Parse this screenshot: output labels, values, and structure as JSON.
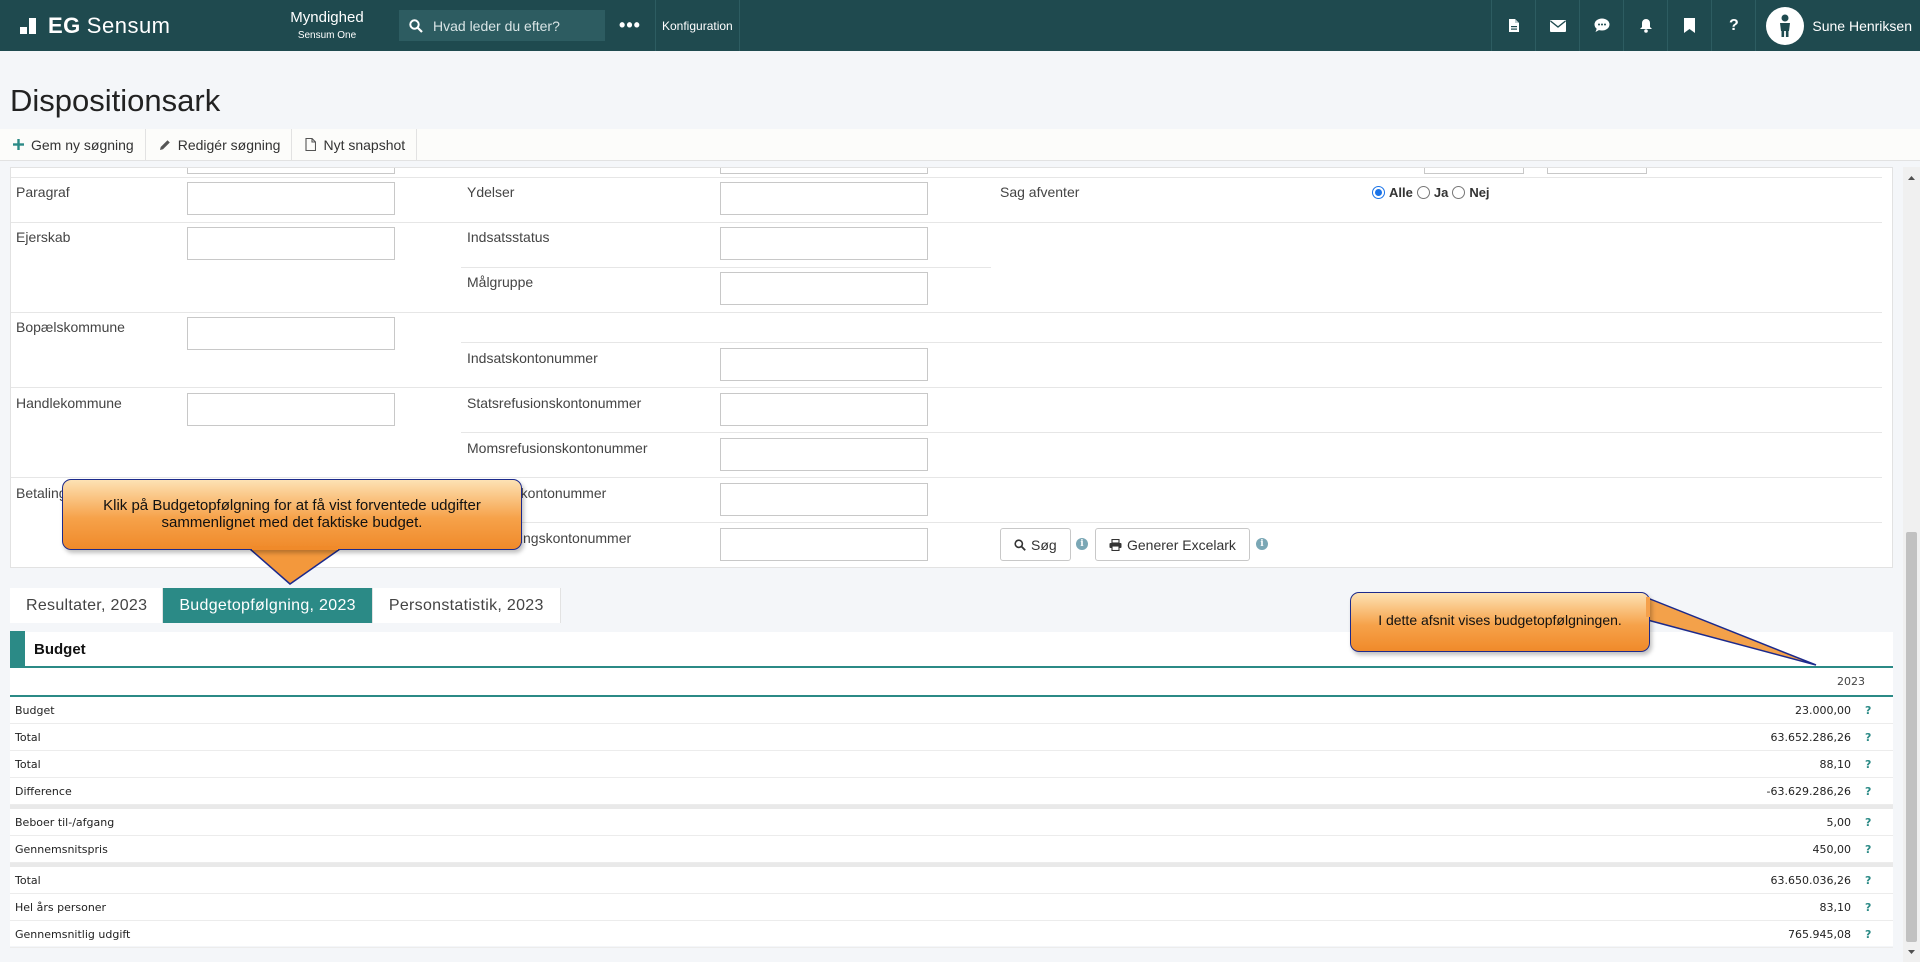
{
  "topnav": {
    "logo_eg": "EG",
    "logo_name": "Sensum",
    "org_title": "Myndighed",
    "org_subtitle": "Sensum One",
    "search_placeholder": "Hvad leder du efter?",
    "more": "•••",
    "config": "Konfiguration",
    "icons": [
      "document-icon",
      "mail-icon",
      "chat-icon",
      "bell-icon",
      "bookmark-icon",
      "help-icon"
    ],
    "help_label": "?",
    "user_name": "Sune Henriksen"
  },
  "page": {
    "title": "Dispositionsark"
  },
  "toolbar": {
    "save": "Gem ny søgning",
    "edit": "Redigér søgning",
    "snapshot": "Nyt snapshot"
  },
  "form": {
    "paragraf": "Paragraf",
    "ydelser": "Ydelser",
    "sag_afventer": "Sag afventer",
    "radio_alle": "Alle",
    "radio_ja": "Ja",
    "radio_nej": "Nej",
    "ejerskab": "Ejerskab",
    "indsatsstatus": "Indsatsstatus",
    "maalgruppe": "Målgruppe",
    "bopael": "Bopælskommune",
    "indsatskonto": "Indsatskontonummer",
    "handle": "Handlekommune",
    "statsref": "Statsrefusionskontonummer",
    "momsref": "Momsrefusionskontonummer",
    "betaling_partial": "Betaling",
    "konto_partial1": "d kontonummer",
    "konto_partial2": "alingskontonummer",
    "search_btn": "Søg",
    "excel_btn": "Generer Excelark",
    "info": "i"
  },
  "tabs": [
    {
      "label": "Resultater, 2023"
    },
    {
      "label": "Budgetopfølgning, 2023"
    },
    {
      "label": "Personstatistik, 2023"
    }
  ],
  "budget": {
    "heading": "Budget",
    "year": "2023",
    "help": "?",
    "rows": [
      {
        "name": "Budget",
        "value": "23.000,00"
      },
      {
        "name": "Total",
        "value": "63.652.286,26"
      },
      {
        "name": "Total",
        "value": "88,10"
      },
      {
        "name": "Difference",
        "value": "-63.629.286,26"
      },
      {
        "name": "Beboer til-/afgang",
        "value": "5,00"
      },
      {
        "name": "Gennemsnitspris",
        "value": "450,00"
      },
      {
        "name": "Total",
        "value": "63.650.036,26"
      },
      {
        "name": "Hel års personer",
        "value": "83,10"
      },
      {
        "name": "Gennemsnitlig udgift",
        "value": "765.945,08"
      }
    ]
  },
  "callouts": {
    "tab_hint_line1": "Klik på Budgetopfølgning for at få vist forventede udgifter",
    "tab_hint_line2": "sammenlignet med det faktiske budget.",
    "section_hint": "I dette afsnit vises budgetopfølgningen."
  }
}
